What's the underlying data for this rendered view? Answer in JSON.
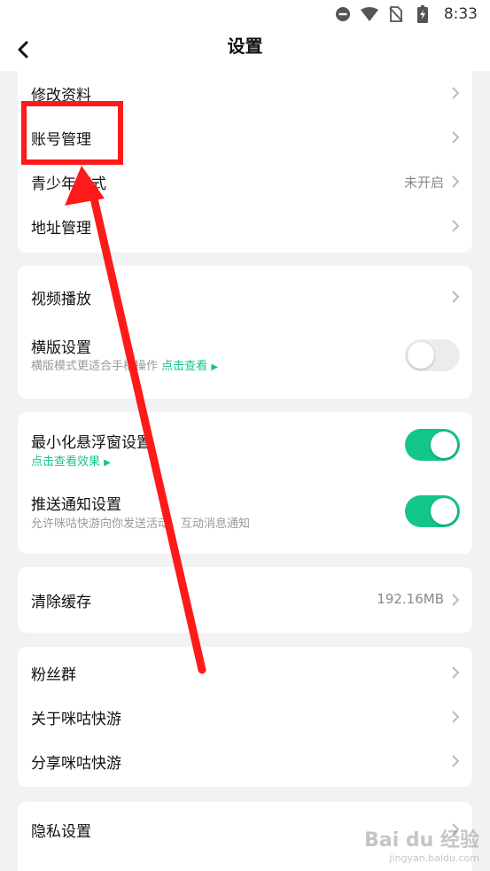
{
  "status_bar": {
    "time": "8:33",
    "icons": [
      "do-not-disturb-icon",
      "wifi-icon",
      "no-sim-icon",
      "battery-icon"
    ]
  },
  "header": {
    "title": "设置"
  },
  "groups": {
    "profile": {
      "edit_profile": "修改资料",
      "account_management": "账号管理",
      "teen_mode": "青少年模式",
      "teen_mode_value": "未开启",
      "address_management": "地址管理"
    },
    "playback": {
      "video_playback": "视频播放",
      "landscape_settings": "横版设置",
      "landscape_desc": "横版模式更适合手柄操作",
      "landscape_link": "点击查看",
      "landscape_on": false
    },
    "floating": {
      "minimize_float": "最小化悬浮窗设置",
      "minimize_link": "点击查看效果",
      "minimize_on": true,
      "push_notification": "推送通知设置",
      "push_desc": "允许咪咕快游向你发送活动、互动消息通知",
      "push_on": true
    },
    "cache": {
      "clear_cache": "清除缓存",
      "cache_size": "192.16MB"
    },
    "about": {
      "fan_group": "粉丝群",
      "about_app": "关于咪咕快游",
      "share_app": "分享咪咕快游"
    },
    "privacy": {
      "privacy_settings": "隐私设置"
    }
  },
  "watermark": {
    "logo": "Bai du 经验",
    "sub": "jingyan.baidu.com"
  },
  "colors": {
    "accent": "#13c68a",
    "annotation": "#ff1a1a",
    "background": "#f2f2f4"
  }
}
